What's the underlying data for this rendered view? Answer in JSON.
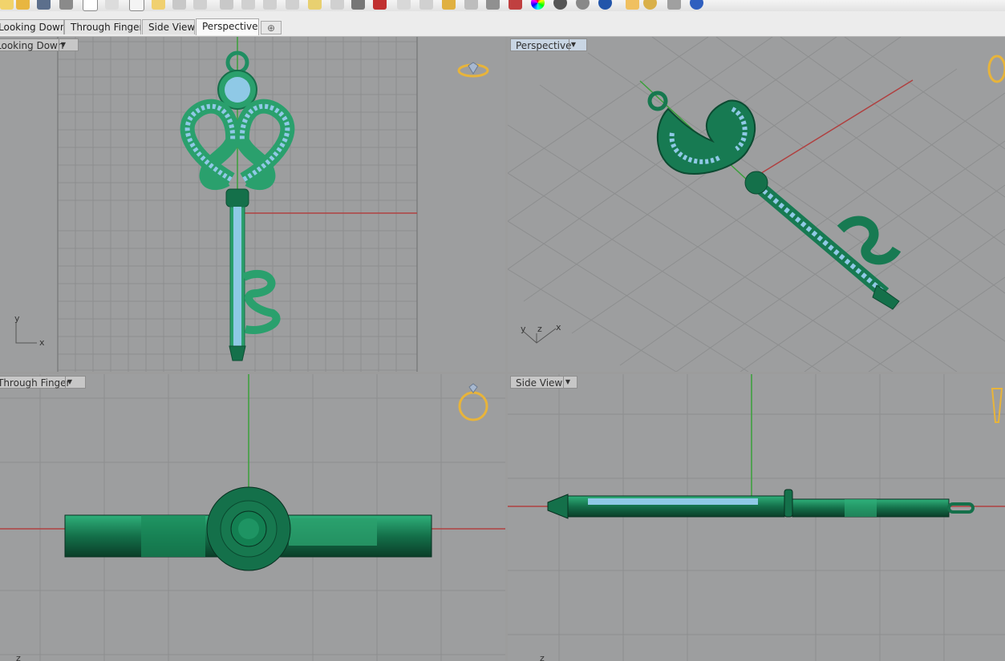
{
  "tabs": [
    {
      "label": "Looking Down"
    },
    {
      "label": "Through Finger"
    },
    {
      "label": "Side View"
    },
    {
      "label": "Perspective"
    }
  ],
  "tab_add_symbol": "⊕",
  "viewports": {
    "top": {
      "label": "Looking Down"
    },
    "perspective": {
      "label": "Perspective"
    },
    "front": {
      "label": "Through Finger"
    },
    "side": {
      "label": "Side View"
    }
  },
  "axis_labels": {
    "x": "x",
    "y": "y",
    "z": "z"
  },
  "colors": {
    "viewport_bg": "#9d9e9f",
    "model_green": "#1f8e62",
    "gem_blue": "#7fc6ea",
    "x_axis": "#b04040",
    "y_axis": "#3aa03a",
    "ring_icon": "#e8b43a"
  }
}
